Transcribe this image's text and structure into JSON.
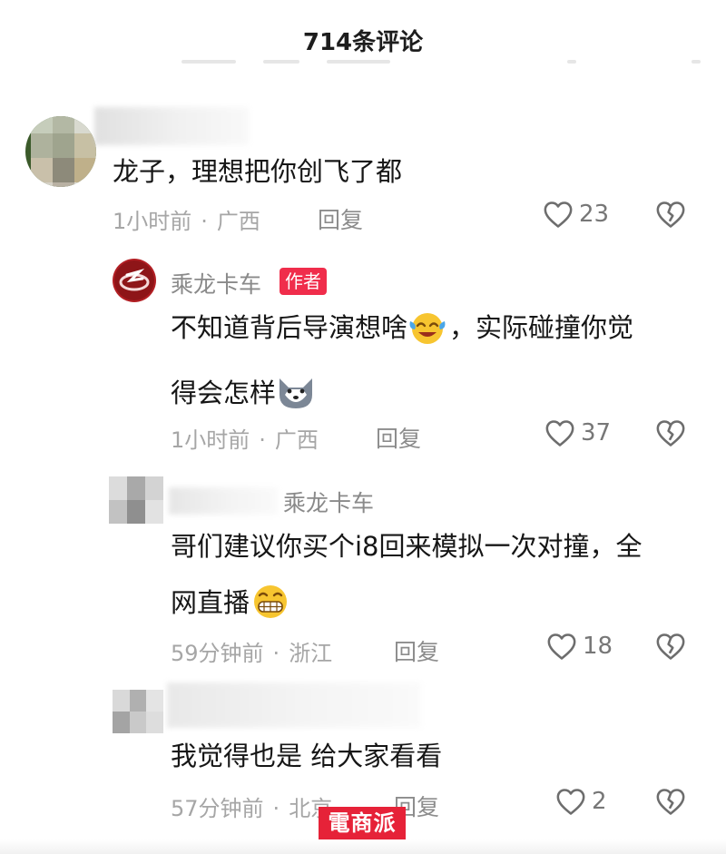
{
  "header": {
    "title": "714条评论"
  },
  "comments": [
    {
      "text_lines": [
        "龙子，理想把你创飞了都"
      ],
      "time": "1小时前",
      "location": "广西",
      "reply_label": "回复",
      "likes": "23"
    },
    {
      "author": "乘龙卡车",
      "author_badge": "作者",
      "text_lines": [
        "不知道背后导演想啥",
        "，实际碰撞你觉",
        "得会怎样"
      ],
      "time": "1小时前",
      "location": "广西",
      "reply_label": "回复",
      "likes": "37"
    },
    {
      "reply_to": "乘龙卡车",
      "text_lines": [
        "哥们建议你买个i8回来模拟一次对撞，全",
        "网直播"
      ],
      "time": "59分钟前",
      "location": "浙江",
      "reply_label": "回复",
      "likes": "18"
    },
    {
      "text_lines": [
        "我觉得也是 给大家看看"
      ],
      "time": "57分钟前",
      "location": "北京",
      "reply_label": "回复",
      "likes": "2"
    }
  ],
  "watermark": {
    "text": "電商派"
  },
  "icons": {
    "like": "heart-outline-icon",
    "dislike": "broken-heart-icon",
    "emoji_1": "laughing-tears-emoji",
    "emoji_2": "wolf-emoji",
    "emoji_3": "grinning-emoji"
  },
  "colors": {
    "author_badge": "#f02d4b",
    "watermark": "#e62238",
    "meta_text": "#a6a6a6"
  }
}
